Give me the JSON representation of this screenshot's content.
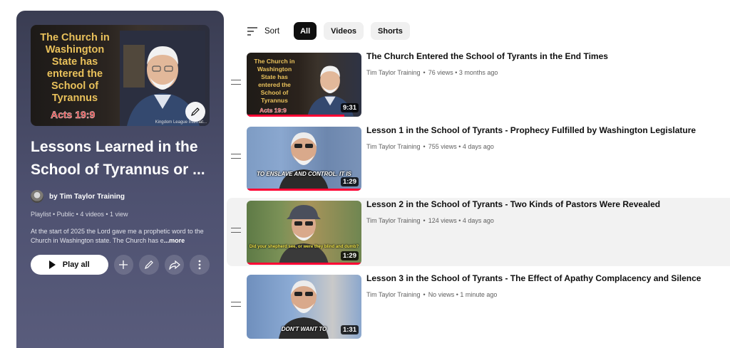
{
  "playlist": {
    "thumbnail_text": "The Church in Washington State has entered the School of Tyrannus",
    "thumbnail_verse": "Acts 19:9",
    "thumbnail_caption": "Kingdom League Internat...",
    "title_line1": "Lessons Learned in the",
    "title_line2": "School of Tyrannus or ...",
    "owner_prefix": "by",
    "owner": "Tim Taylor Training",
    "meta": "Playlist • Public • 4 videos • 1 view",
    "description": "At the start of 2025 the Lord gave me a prophetic word to the Church in Washington state.  The Church has e",
    "more_label": "...more",
    "play_all_label": "Play all"
  },
  "filters": {
    "sort_label": "Sort",
    "chips": [
      "All",
      "Videos",
      "Shorts"
    ],
    "active_chip": "All"
  },
  "videos": [
    {
      "title": "The Church Entered the School of Tyrants in the End Times",
      "channel": "Tim Taylor Training",
      "stats": "76 views • 3 months ago",
      "duration": "9:31",
      "watched_fraction": 0.85,
      "thumb_text": "The Church in Washington State has entered the School of Tyrannus",
      "thumb_verse": "Acts 19:9"
    },
    {
      "title": "Lesson 1 in the School of Tyrants - Prophecy Fulfilled by Washington Legislature",
      "channel": "Tim Taylor Training",
      "stats": "755 views • 4 days ago",
      "duration": "1:29",
      "watched_fraction": 1.0,
      "thumb_caption": "TO ENSLAVE AND CONTROL. IT IS"
    },
    {
      "title": "Lesson 2 in the School of Tyrants - Two Kinds of Pastors Were Revealed",
      "channel": "Tim Taylor Training",
      "stats": "124 views • 4 days ago",
      "duration": "1:29",
      "watched_fraction": 1.0,
      "thumb_caption": "Did your shepherd see, or were they blind and dumb?"
    },
    {
      "title": "Lesson 3 in the School of Tyrants - The Effect of Apathy Complacency and Silence",
      "channel": "Tim Taylor Training",
      "stats": "No views • 1 minute ago",
      "duration": "1:31",
      "watched_fraction": 0,
      "thumb_caption": "DON'T WANT TO"
    }
  ],
  "icons": [
    "pencil-icon",
    "plus-icon",
    "share-icon",
    "more-vert-icon",
    "sort-icon",
    "drag-handle-icon",
    "play-icon"
  ]
}
